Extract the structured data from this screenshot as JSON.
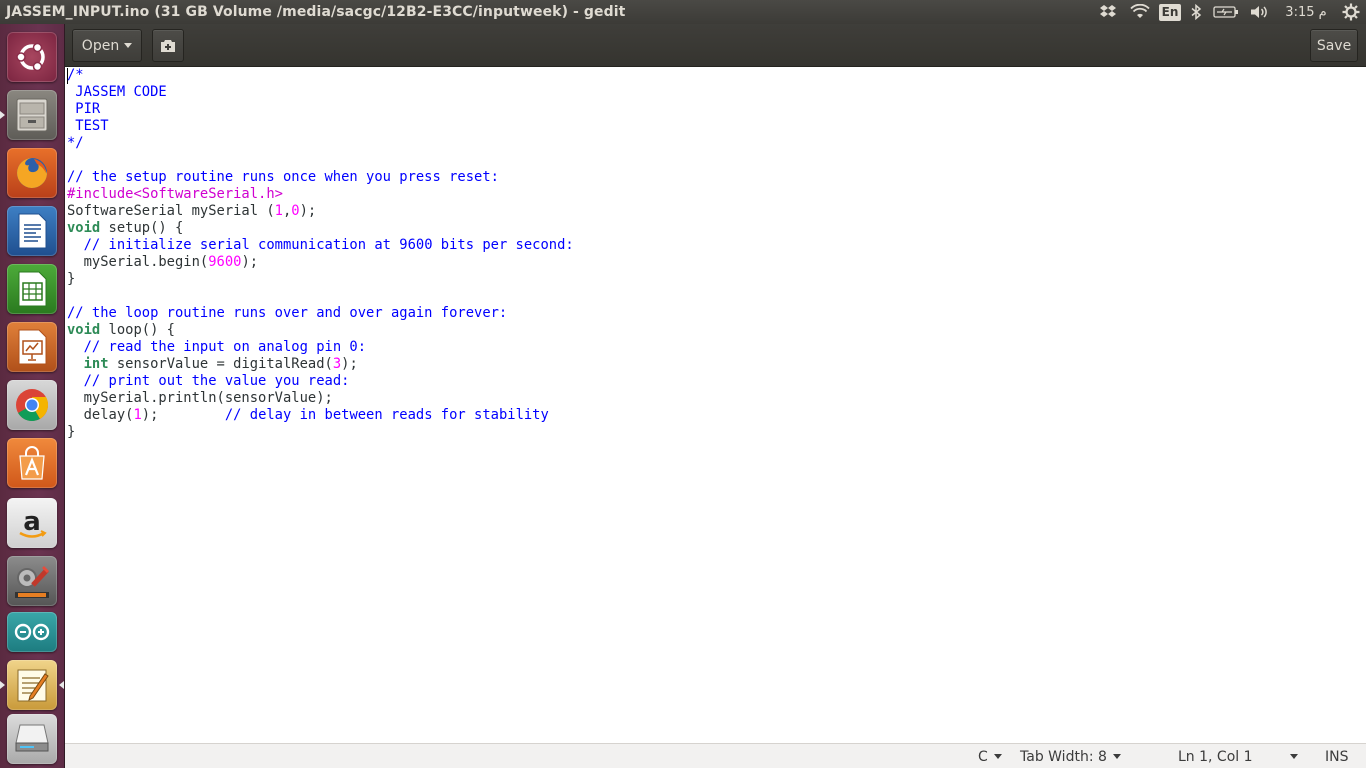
{
  "window": {
    "title": "JASSEM_INPUT.ino (31 GB Volume /media/sacgc/12B2-E3CC/inputweek) - gedit"
  },
  "panel": {
    "language_indicator": "En",
    "clock": "3:15 م"
  },
  "toolbar": {
    "open_label": "Open",
    "save_label": "Save"
  },
  "launcher": {
    "items": [
      {
        "name": "dash-home",
        "icon": "ubuntu-logo-icon"
      },
      {
        "name": "files",
        "icon": "file-cabinet-icon"
      },
      {
        "name": "firefox",
        "icon": "firefox-icon"
      },
      {
        "name": "libreoffice-writer",
        "icon": "writer-icon"
      },
      {
        "name": "libreoffice-calc",
        "icon": "calc-icon"
      },
      {
        "name": "libreoffice-impress",
        "icon": "impress-icon"
      },
      {
        "name": "chrome",
        "icon": "chrome-icon"
      },
      {
        "name": "software-center",
        "icon": "shopping-bag-icon"
      },
      {
        "name": "amazon",
        "icon": "amazon-icon"
      },
      {
        "name": "system-settings",
        "icon": "settings-wrench-icon"
      },
      {
        "name": "arduino",
        "icon": "arduino-icon"
      },
      {
        "name": "gedit",
        "icon": "text-editor-icon"
      },
      {
        "name": "scanner",
        "icon": "scanner-icon"
      }
    ]
  },
  "editor": {
    "lines": [
      "/*",
      " JASSEM CODE",
      " PIR",
      " TEST",
      "*/",
      "",
      "// the setup routine runs once when you press reset:",
      "#include<SoftwareSerial.h>",
      "SoftwareSerial mySerial (1,0);",
      "void setup() {",
      "  // initialize serial communication at 9600 bits per second:",
      "  mySerial.begin(9600);",
      "}",
      "",
      "// the loop routine runs over and over again forever:",
      "void loop() {",
      "  // read the input on analog pin 0:",
      "  int sensorValue = digitalRead(3);",
      "  // print out the value you read:",
      "  mySerial.println(sensorValue);",
      "  delay(1);        // delay in between reads for stability",
      "}"
    ]
  },
  "statusbar": {
    "language": "C",
    "tab_width": "Tab Width: 8",
    "position": "Ln 1, Col 1",
    "mode": "INS"
  }
}
